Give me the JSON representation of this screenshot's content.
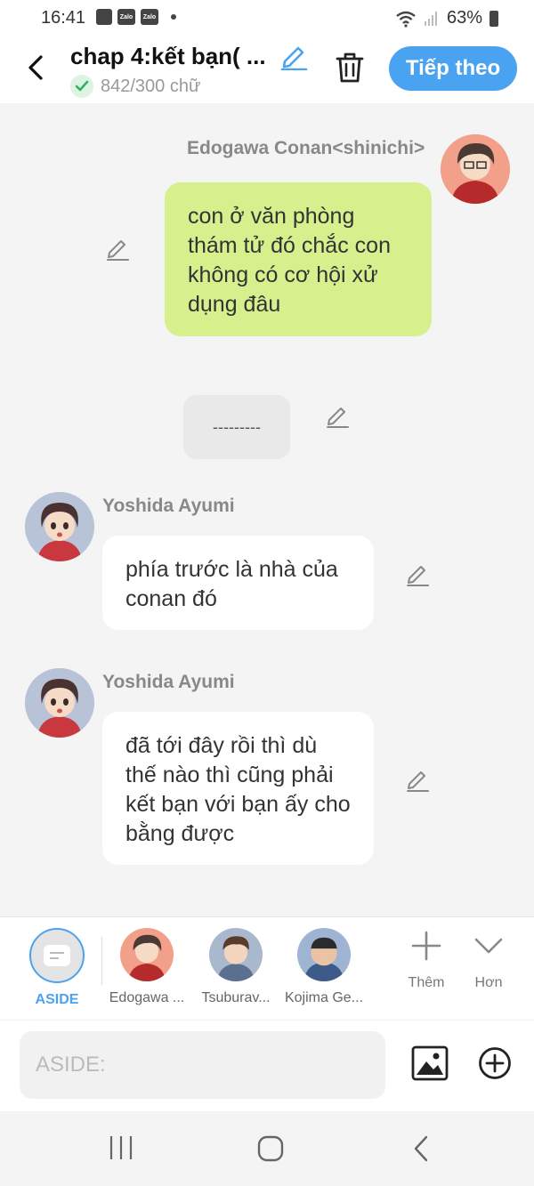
{
  "status_bar": {
    "time": "16:41",
    "battery": "63%",
    "zalo_label": "Zalo"
  },
  "header": {
    "title": "chap 4:kết bạn( ...",
    "word_count": "842/300 chữ",
    "next_label": "Tiếp theo"
  },
  "messages": [
    {
      "speaker": "Edogawa Conan<shinichi>",
      "text": "con ở văn phòng thám tử đó chắc con không có cơ hội xử dụng đâu"
    },
    {
      "text": "---------"
    },
    {
      "speaker": "Yoshida Ayumi",
      "text": "phía trước là nhà của conan đó"
    },
    {
      "speaker": "Yoshida Ayumi",
      "text": "đã tới đây rồi thì dù thế nào thì cũng phải kết bạn với bạn ấy cho bằng được"
    }
  ],
  "characters": [
    {
      "label": "ASIDE"
    },
    {
      "label": "Edogawa ..."
    },
    {
      "label": "Tsuburav..."
    },
    {
      "label": "Kojima Ge..."
    }
  ],
  "tools": {
    "add_label": "Thêm",
    "more_label": "Hơn"
  },
  "input": {
    "placeholder": "ASIDE:"
  },
  "colors": {
    "accent": "#4aa3f0",
    "green_bubble": "#d6f08e",
    "check": "#2db55d"
  },
  "icons": [
    "back-arrow-icon",
    "pencil-icon",
    "check-icon",
    "trash-icon",
    "plus-icon",
    "chevron-down-icon",
    "image-icon",
    "add-circle-icon",
    "recents-icon",
    "home-icon",
    "back-nav-icon"
  ]
}
